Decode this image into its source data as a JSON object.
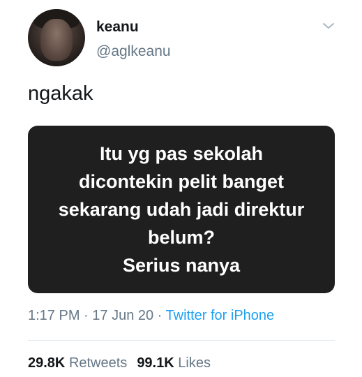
{
  "user": {
    "name": "keanu",
    "handle": "@aglkeanu"
  },
  "tweet": {
    "text": "ngakak",
    "image_text": [
      "Itu yg pas sekolah",
      "dicontekin pelit banget",
      "sekarang udah jadi direktur",
      "belum?",
      "Serius nanya"
    ],
    "time": "1:17 PM",
    "separator": " · ",
    "date": "17 Jun 20",
    "source": "Twitter for iPhone"
  },
  "stats": {
    "retweets_count": "29.8K",
    "retweets_label": "Retweets",
    "likes_count": "99.1K",
    "likes_label": "Likes"
  },
  "icons": {
    "menu": "chevron-down-icon"
  },
  "colors": {
    "link": "#1da1f2",
    "secondary_text": "#657786",
    "image_background": "#1f1f1f"
  }
}
